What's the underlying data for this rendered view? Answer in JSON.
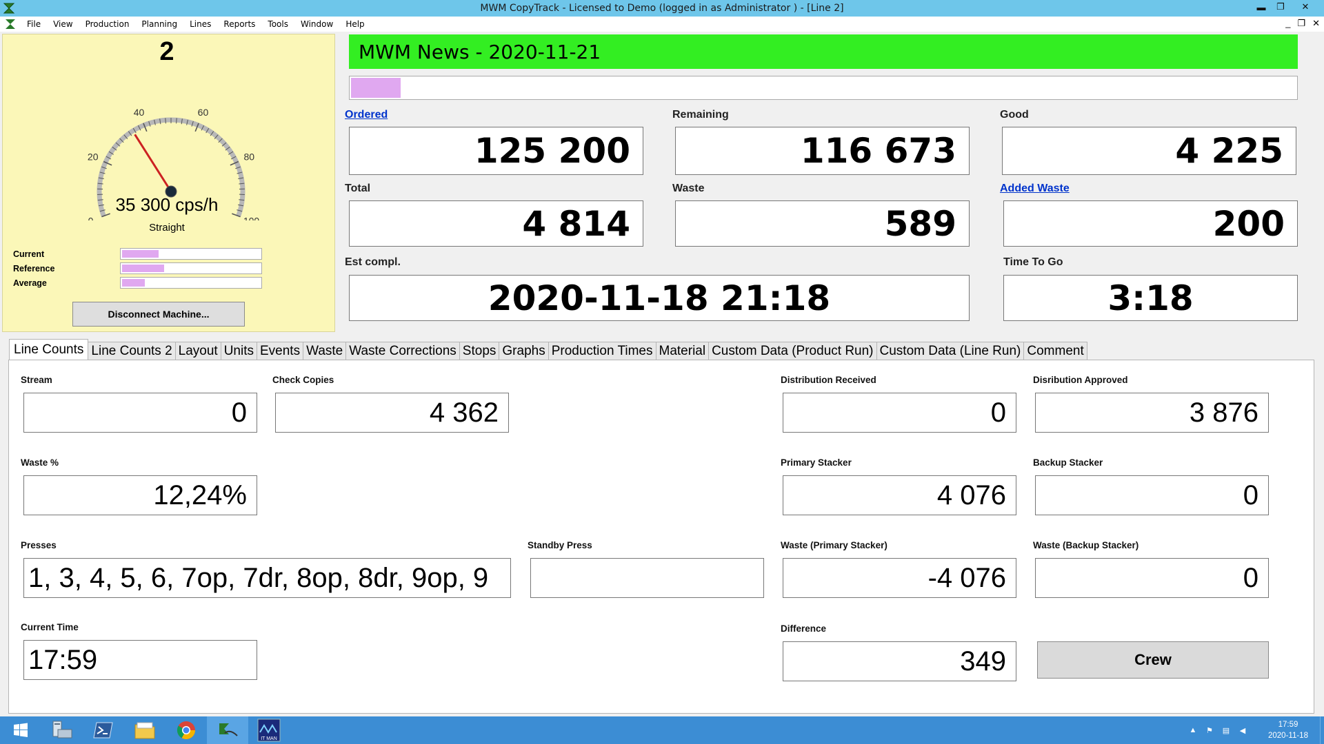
{
  "window": {
    "title": "MWM CopyTrack - Licensed to Demo (logged in as Administrator ) - [Line 2]",
    "controls": [
      "▬",
      "❐",
      "✕"
    ]
  },
  "menu": {
    "items": [
      "File",
      "View",
      "Production",
      "Planning",
      "Lines",
      "Reports",
      "Tools",
      "Window",
      "Help"
    ],
    "mdi_controls": [
      "_",
      "❐",
      "✕"
    ]
  },
  "machine": {
    "number": "2",
    "gauge": {
      "ticks": [
        "0",
        "20",
        "40",
        "60",
        "80",
        "100"
      ],
      "value": 35.3,
      "max": 100
    },
    "speed": "35 300 cps/h",
    "mode": "Straight",
    "bars": [
      {
        "label": "Current",
        "value": 0.28
      },
      {
        "label": "Reference",
        "value": 0.32
      },
      {
        "label": "Average",
        "value": 0.18
      }
    ],
    "disconnect_label": "Disconnect Machine..."
  },
  "header": {
    "news_title": "MWM News - 2020-11-21",
    "progress": 0.055
  },
  "summary": {
    "ordered": {
      "label": "Ordered",
      "value": "125 200"
    },
    "remaining": {
      "label": "Remaining",
      "value": "116 673"
    },
    "good": {
      "label": "Good",
      "value": "4 225"
    },
    "total": {
      "label": "Total",
      "value": "4 814"
    },
    "waste": {
      "label": "Waste",
      "value": "589"
    },
    "added_waste": {
      "label": "Added Waste",
      "value": "200"
    },
    "est_compl": {
      "label": "Est compl.",
      "value": "2020-11-18 21:18"
    },
    "time_to_go": {
      "label": "Time To Go",
      "value": "3:18"
    }
  },
  "tabs": [
    "Line Counts",
    "Line Counts 2",
    "Layout",
    "Units",
    "Events",
    "Waste",
    "Waste Corrections",
    "Stops",
    "Graphs",
    "Production Times",
    "Material",
    "Custom Data (Product Run)",
    "Custom Data (Line Run)",
    "Comment"
  ],
  "line_counts": {
    "stream": {
      "label": "Stream",
      "value": "0"
    },
    "check_copies": {
      "label": "Check Copies",
      "value": "4 362"
    },
    "distribution_received": {
      "label": "Distribution Received",
      "value": "0"
    },
    "distribution_approved": {
      "label": "Disribution Approved",
      "value": "3 876"
    },
    "waste_pct": {
      "label": "Waste %",
      "value": "12,24%"
    },
    "primary_stacker": {
      "label": "Primary Stacker",
      "value": "4 076"
    },
    "backup_stacker": {
      "label": "Backup Stacker",
      "value": "0"
    },
    "presses": {
      "label": "Presses",
      "value": "1, 3, 4, 5, 6, 7op, 7dr, 8op, 8dr, 9op, 9"
    },
    "standby_press": {
      "label": "Standby Press",
      "value": ""
    },
    "waste_primary": {
      "label": "Waste (Primary Stacker)",
      "value": "-4 076"
    },
    "waste_backup": {
      "label": "Waste (Backup Stacker)",
      "value": "0"
    },
    "current_time": {
      "label": "Current Time",
      "value": "17:59"
    },
    "difference": {
      "label": "Difference",
      "value": "349"
    },
    "crew_label": "Crew"
  },
  "taskbar": {
    "clock_time": "17:59",
    "clock_date": "2020-11-18",
    "it_man_label": "IT MAN"
  }
}
